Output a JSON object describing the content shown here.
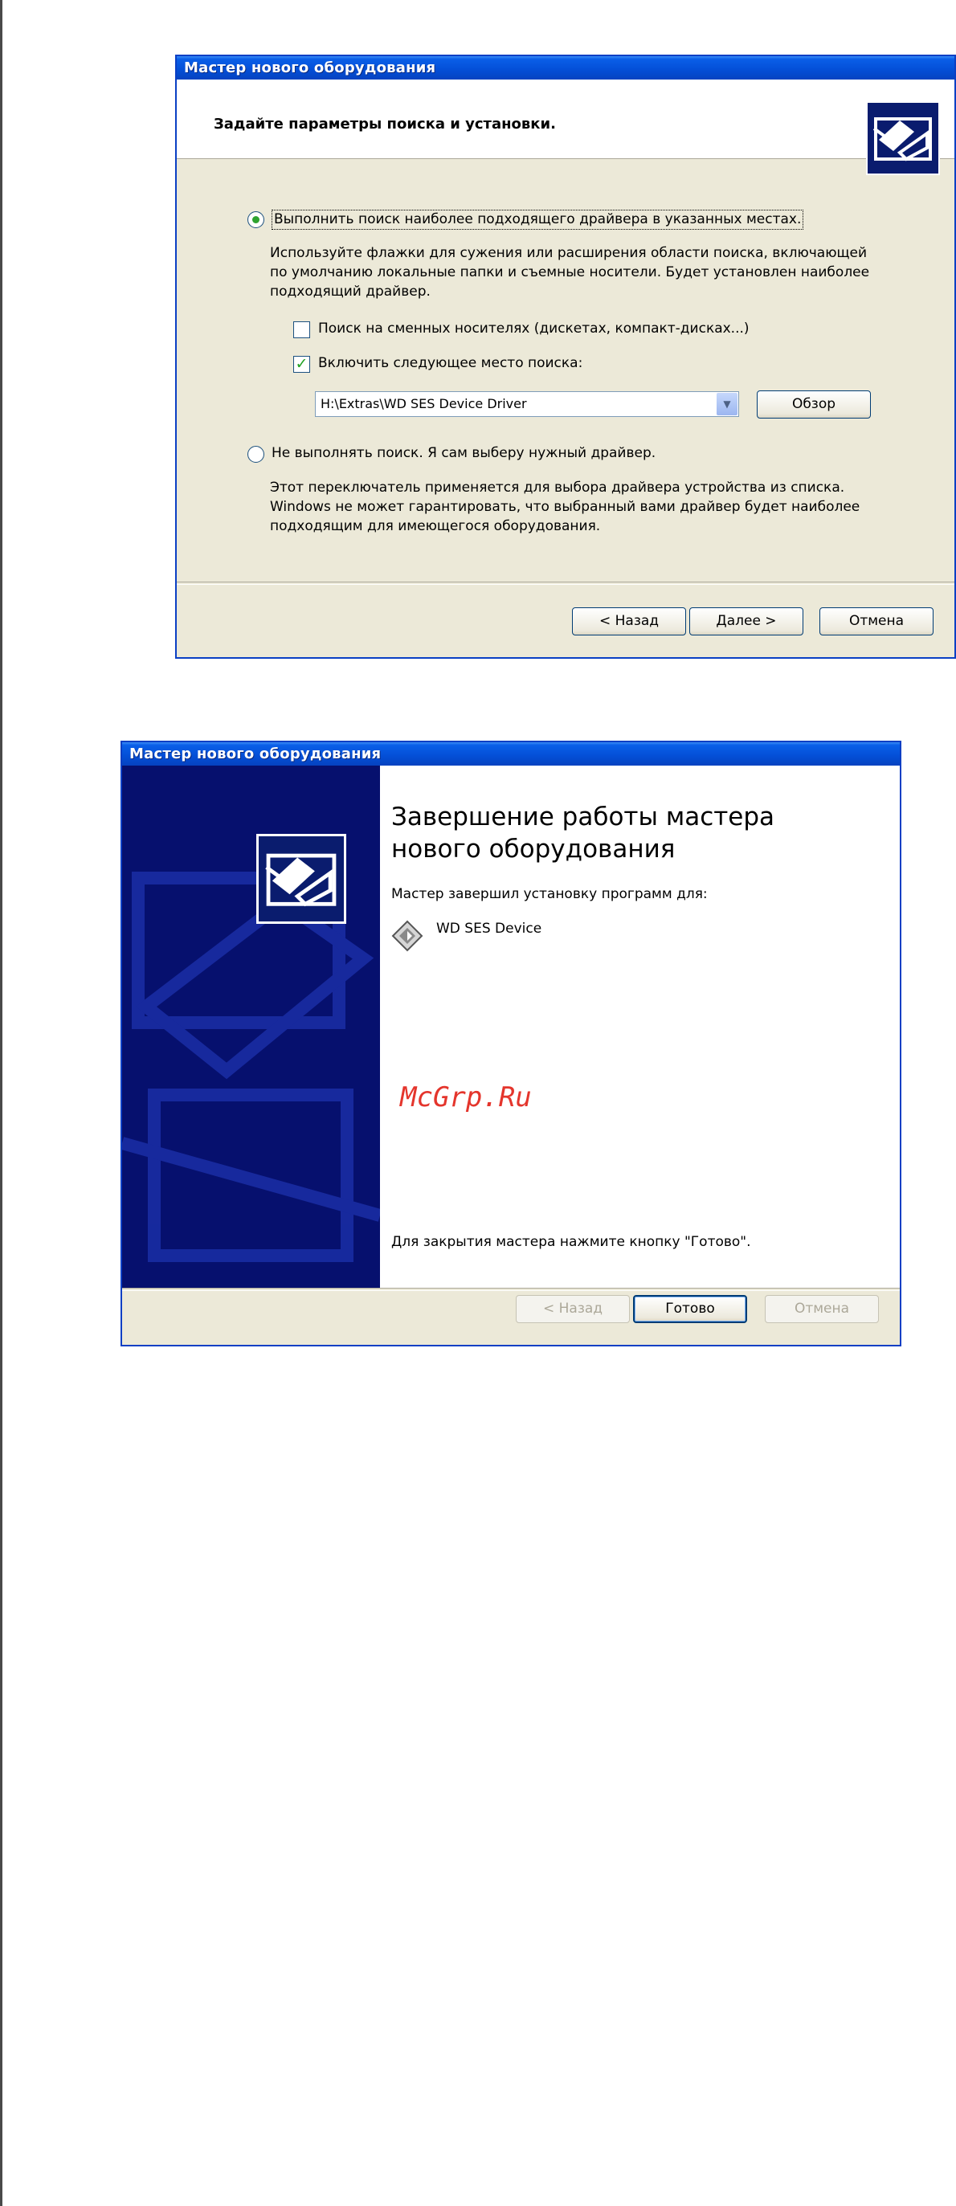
{
  "dialog1": {
    "title": "Мастер нового оборудования",
    "header": "Задайте параметры поиска и установки.",
    "radio_search": "Выполнить поиск наиболее подходящего драйвера в указанных местах.",
    "search_desc": [
      "Используйте флажки для сужения или расширения области поиска, включающей",
      "по умолчанию локальные папки и съемные носители. Будет установлен наиболее",
      "подходящий драйвер."
    ],
    "check_removable": "Поиск на сменных носителях (дискетах, компакт-дисках...)",
    "check_location": "Включить следующее место поиска:",
    "location_value": "H:\\Extras\\WD SES Device Driver",
    "browse_label": "Обзор",
    "radio_nosearch": "Не выполнять поиск. Я сам выберу нужный драйвер.",
    "nosearch_desc": [
      "Этот переключатель применяется для выбора драйвера устройства из списка.",
      "Windows не может гарантировать, что выбранный вами драйвер будет наиболее",
      "подходящим для имеющегося оборудования."
    ],
    "back_label": "< Назад",
    "next_label": "Далее >",
    "cancel_label": "Отмена"
  },
  "dialog2": {
    "title": "Мастер нового оборудования",
    "heading": [
      "Завершение работы мастера",
      "нового оборудования"
    ],
    "installed_for": "Мастер завершил установку программ для:",
    "device_name": "WD SES Device",
    "close_hint": "Для закрытия мастера нажмите кнопку \"Готово\".",
    "back_label": "< Назад",
    "finish_label": "Готово",
    "cancel_label": "Отмена"
  },
  "watermark": "McGrp.Ru",
  "colors": {
    "accent": "#0a5fe8",
    "sidepanel": "#06106e",
    "watermark": "#e4352c",
    "dialog_bg": "#ece9d8"
  }
}
